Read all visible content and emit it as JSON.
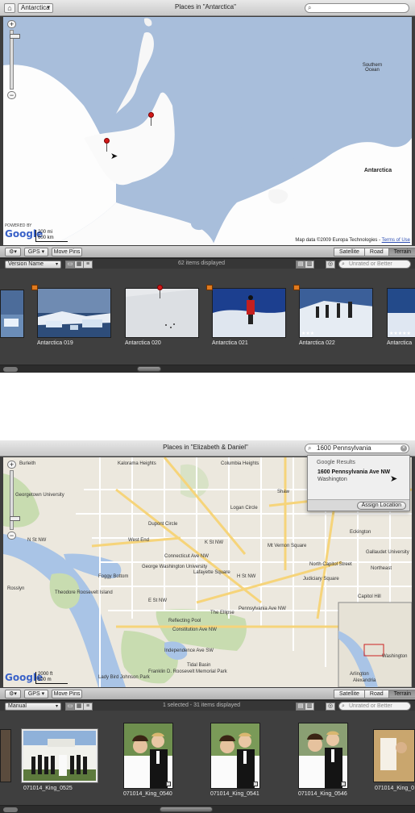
{
  "panel1": {
    "header": {
      "popup_label": "Antarctica",
      "title": "Places in \"Antarctica\"",
      "search_value": ""
    },
    "map": {
      "label_ocean": "Southern Ocean",
      "label_continent": "Antarctica",
      "scale_top": "200 mi",
      "scale_bottom": "600 km",
      "powered_by": "POWERED BY",
      "logo": "Google",
      "credit": "Map data ©2009 Europa Technologies - ",
      "terms": "Terms of Use"
    },
    "toolbar": {
      "gps": "GPS",
      "move_pins": "Move Pins",
      "satellite": "Satellite",
      "road": "Road",
      "terrain": "Terrain",
      "active_mode": "Terrain"
    },
    "filterbar": {
      "sort": "Version Name",
      "status": "62 items displayed",
      "filter_placeholder": "Unrated or Better"
    },
    "thumbnails": [
      {
        "label": "",
        "stars": "",
        "badge": false
      },
      {
        "label": "Antarctica 019",
        "stars": "",
        "badge": true
      },
      {
        "label": "Antarctica 020",
        "stars": "",
        "badge": false
      },
      {
        "label": "Antarctica 021",
        "stars": "",
        "badge": true
      },
      {
        "label": "Antarctica 022",
        "stars": "★★★",
        "badge": true
      },
      {
        "label": "Antarctica",
        "stars": "★★★★★",
        "badge": false
      }
    ]
  },
  "panel2": {
    "header": {
      "popup_label": "",
      "title": "Places in \"Elizabeth & Daniel\"",
      "search_value": "1600 Pennsylvania"
    },
    "results": {
      "heading": "Google Results",
      "address": "1600 Pennsylvania Ave NW",
      "city": "Washington",
      "assign": "Assign Location"
    },
    "map": {
      "scale_top": "2000 ft",
      "scale_bottom": "500 m",
      "logo": "Google",
      "streets": [
        "Kalorama Heights",
        "Dupont Circle",
        "West End",
        "K St NW",
        "Connecticut Ave NW",
        "Logan Circle",
        "Shaw",
        "Mt Vernon Square",
        "Foggy Bottom",
        "George Washington University",
        "Lafayette Square",
        "Judiciary Square",
        "Theodore Roosevelt Island",
        "Reflecting Pool",
        "The Ellipse",
        "Constitution Ave NW",
        "Independence Ave SW",
        "Tidal Basin",
        "Lady Bird Johnson Park",
        "Franklin D. Roosevelt Memorial Park",
        "Arlington",
        "Washington",
        "Alexandria",
        "N St NW",
        "Georgetown University",
        "Burleith",
        "Columbia Heights",
        "Capitol Hill",
        "Rosslyn",
        "Pennsylvania Ave NW",
        "E St NW",
        "H St NW",
        "Gallaudet University",
        "Northeast",
        "Eckington",
        "North Capitol Street"
      ]
    },
    "toolbar": {
      "gps": "GPS",
      "move_pins": "Move Pins",
      "satellite": "Satellite",
      "road": "Road",
      "terrain": "Terrain",
      "active_mode": "Terrain"
    },
    "filterbar": {
      "sort": "Manual",
      "status": "1 selected - 31 items displayed",
      "filter_placeholder": "Unrated or Better"
    },
    "thumbnails": [
      {
        "label": ""
      },
      {
        "label": "071014_King_0525"
      },
      {
        "label": "071014_King_0540"
      },
      {
        "label": "071014_King_0541"
      },
      {
        "label": "071014_King_0546"
      },
      {
        "label": "071014_King_0"
      }
    ]
  },
  "colors": {
    "water": "#a8bedb",
    "ice": "#ffffff",
    "road_map_bg": "#ece8de",
    "park": "#c8dcb0",
    "river": "#a9c4e6",
    "pin": "#d21818"
  }
}
